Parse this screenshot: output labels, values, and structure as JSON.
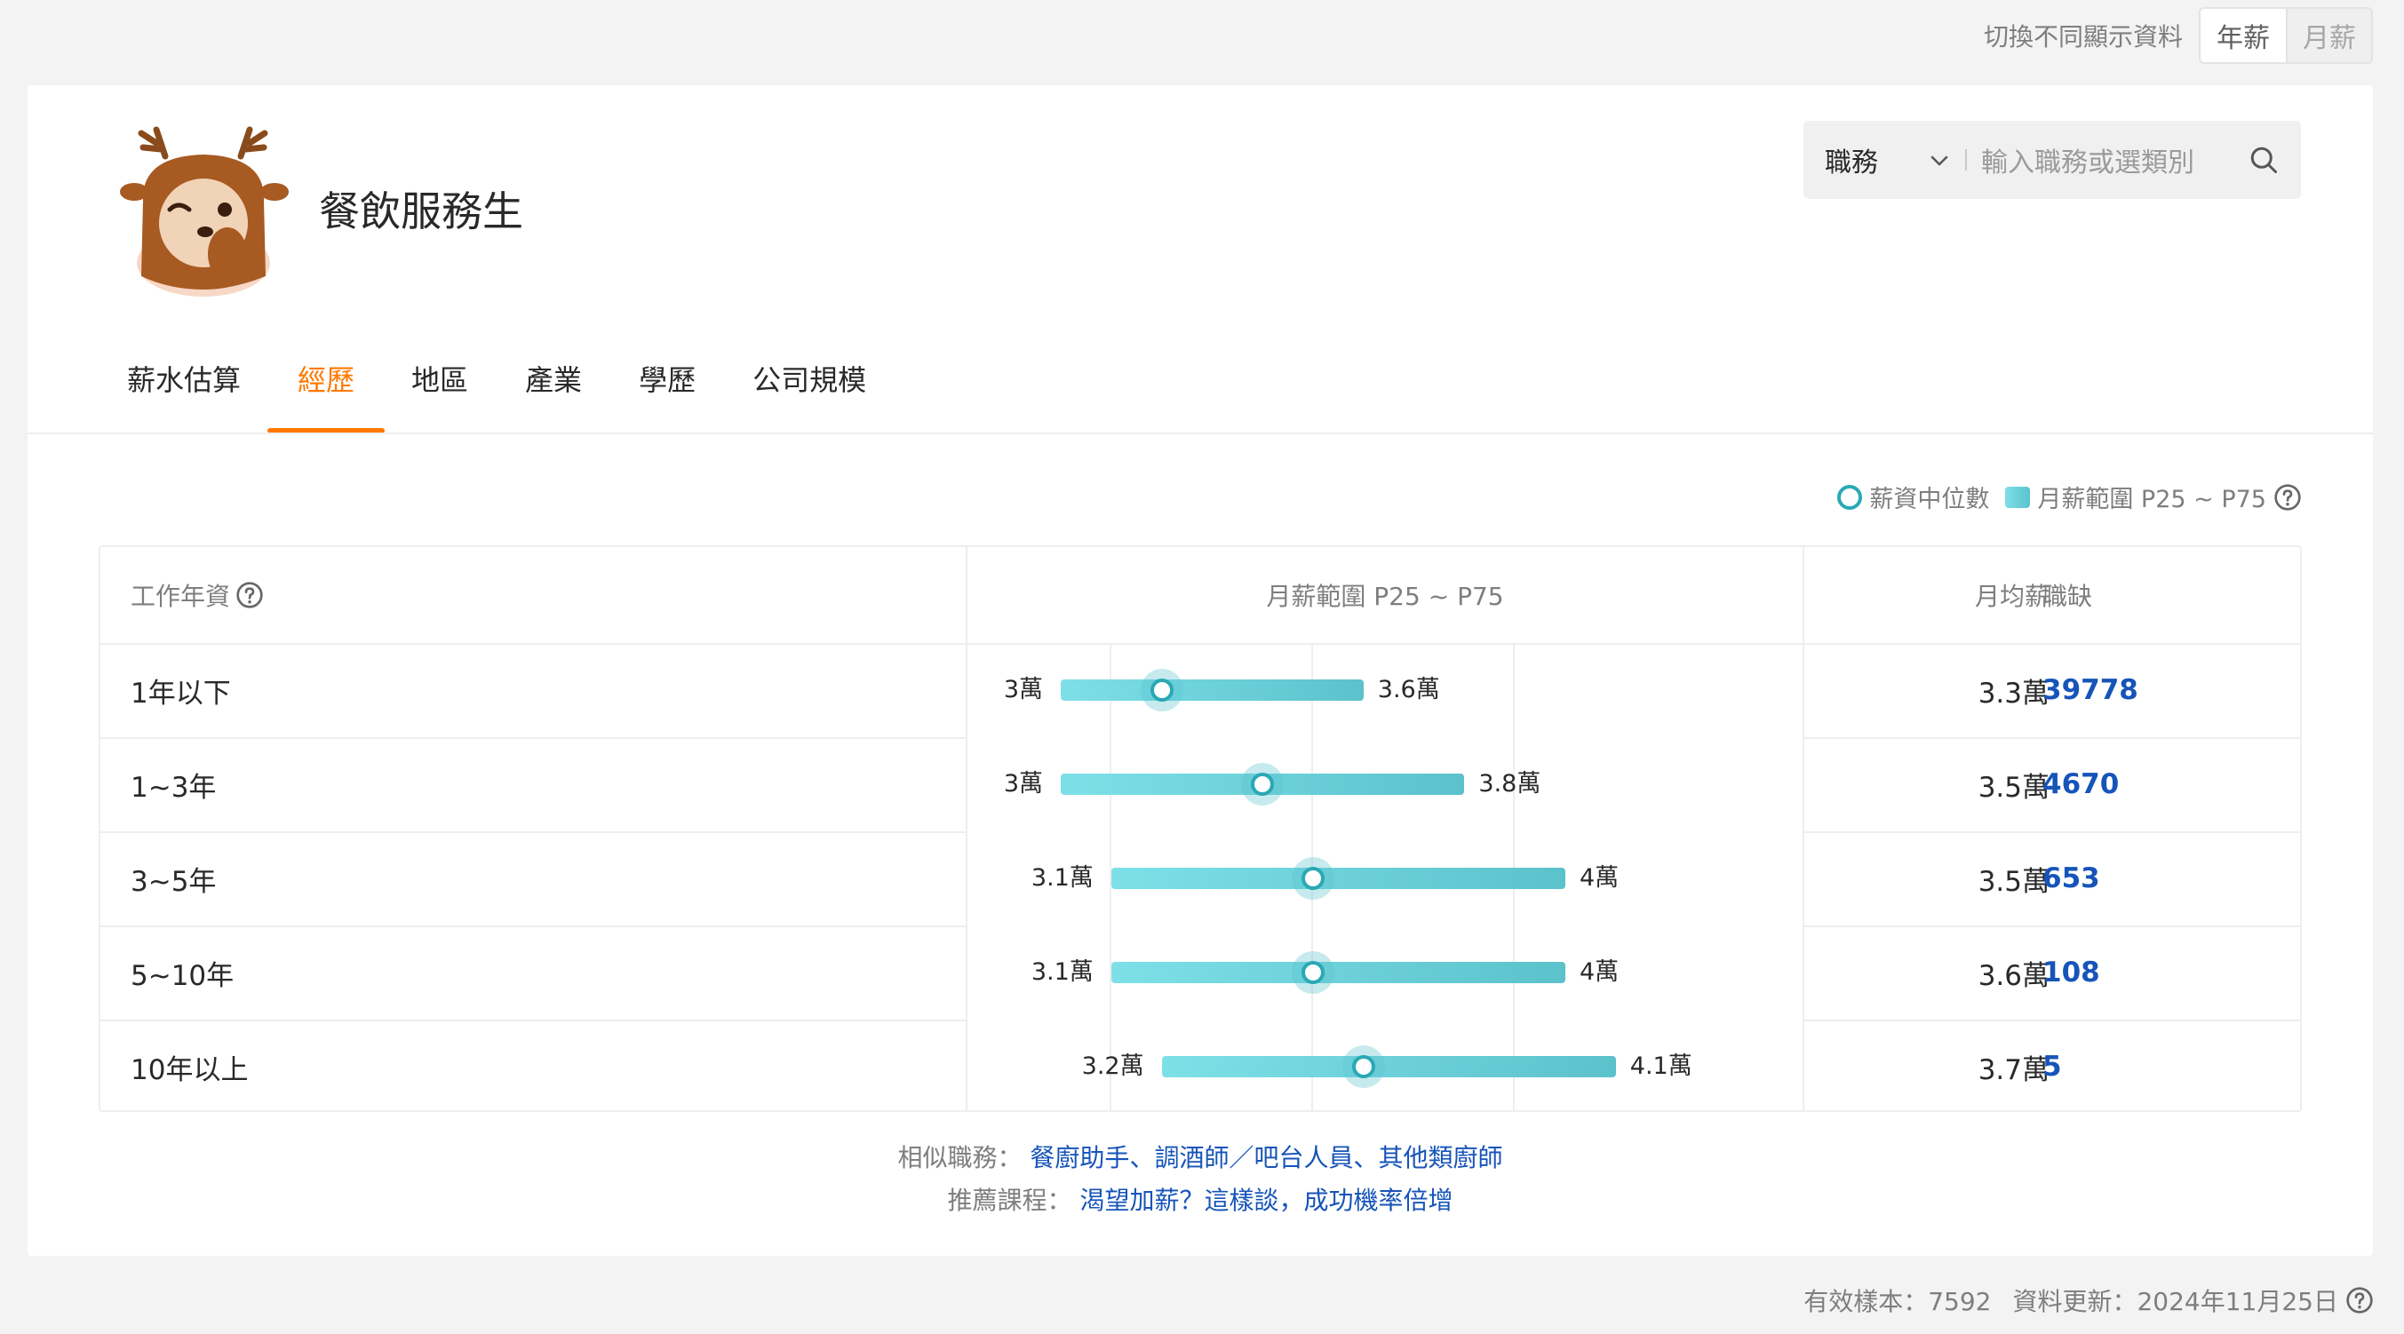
{
  "topbar": {
    "label": "切換不同顯示資料",
    "options": [
      "年薪",
      "月薪"
    ],
    "active": "年薪"
  },
  "header": {
    "title": "餐飲服務生"
  },
  "search": {
    "category": "職務",
    "placeholder": "輸入職務或選類別"
  },
  "tabs": [
    {
      "label": "薪水估算",
      "active": false
    },
    {
      "label": "經歷",
      "active": true
    },
    {
      "label": "地區",
      "active": false
    },
    {
      "label": "產業",
      "active": false
    },
    {
      "label": "學歷",
      "active": false
    },
    {
      "label": "公司規模",
      "active": false
    }
  ],
  "legend": {
    "median": "薪資中位數",
    "range": "月薪範圍 P25 ~ P75"
  },
  "table": {
    "headers": {
      "experience": "工作年資",
      "range": "月薪範圍 P25 ~ P75",
      "avg": "月均薪",
      "jobs": "職缺"
    },
    "rows": [
      {
        "experience": "1年以下",
        "p25": 3.0,
        "p75": 3.6,
        "median": 3.2,
        "p25_label": "3萬",
        "p75_label": "3.6萬",
        "avg": "3.3萬",
        "jobs": "39778"
      },
      {
        "experience": "1~3年",
        "p25": 3.0,
        "p75": 3.8,
        "median": 3.4,
        "p25_label": "3萬",
        "p75_label": "3.8萬",
        "avg": "3.5萬",
        "jobs": "4670"
      },
      {
        "experience": "3~5年",
        "p25": 3.1,
        "p75": 4.0,
        "median": 3.5,
        "p25_label": "3.1萬",
        "p75_label": "4萬",
        "avg": "3.5萬",
        "jobs": "653"
      },
      {
        "experience": "5~10年",
        "p25": 3.1,
        "p75": 4.0,
        "median": 3.5,
        "p25_label": "3.1萬",
        "p75_label": "4萬",
        "avg": "3.6萬",
        "jobs": "108"
      },
      {
        "experience": "10年以上",
        "p25": 3.2,
        "p75": 4.1,
        "median": 3.6,
        "p25_label": "3.2萬",
        "p75_label": "4.1萬",
        "avg": "3.7萬",
        "jobs": "5"
      }
    ]
  },
  "footer": {
    "similar_label": "相似職務：",
    "similar_links": [
      "餐廚助手",
      "調酒師／吧台人員",
      "其他類廚師"
    ],
    "similar_sep": "、",
    "course_label": "推薦課程：",
    "course_link": "渴望加薪？這樣談，成功機率倍增"
  },
  "bottom": {
    "samples": "有效樣本：7592",
    "updated": "資料更新：2024年11月25日"
  },
  "colors": {
    "accent": "#ff7800",
    "link": "#1654b9",
    "bar": "#5bc2cc"
  }
}
